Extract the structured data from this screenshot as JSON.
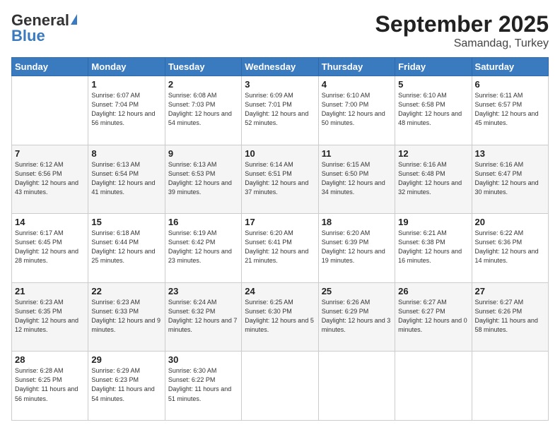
{
  "logo": {
    "general": "General",
    "blue": "Blue"
  },
  "header": {
    "month": "September 2025",
    "location": "Samandag, Turkey"
  },
  "weekdays": [
    "Sunday",
    "Monday",
    "Tuesday",
    "Wednesday",
    "Thursday",
    "Friday",
    "Saturday"
  ],
  "weeks": [
    [
      {
        "day": "",
        "sunrise": "",
        "sunset": "",
        "daylight": ""
      },
      {
        "day": "1",
        "sunrise": "Sunrise: 6:07 AM",
        "sunset": "Sunset: 7:04 PM",
        "daylight": "Daylight: 12 hours and 56 minutes."
      },
      {
        "day": "2",
        "sunrise": "Sunrise: 6:08 AM",
        "sunset": "Sunset: 7:03 PM",
        "daylight": "Daylight: 12 hours and 54 minutes."
      },
      {
        "day": "3",
        "sunrise": "Sunrise: 6:09 AM",
        "sunset": "Sunset: 7:01 PM",
        "daylight": "Daylight: 12 hours and 52 minutes."
      },
      {
        "day": "4",
        "sunrise": "Sunrise: 6:10 AM",
        "sunset": "Sunset: 7:00 PM",
        "daylight": "Daylight: 12 hours and 50 minutes."
      },
      {
        "day": "5",
        "sunrise": "Sunrise: 6:10 AM",
        "sunset": "Sunset: 6:58 PM",
        "daylight": "Daylight: 12 hours and 48 minutes."
      },
      {
        "day": "6",
        "sunrise": "Sunrise: 6:11 AM",
        "sunset": "Sunset: 6:57 PM",
        "daylight": "Daylight: 12 hours and 45 minutes."
      }
    ],
    [
      {
        "day": "7",
        "sunrise": "Sunrise: 6:12 AM",
        "sunset": "Sunset: 6:56 PM",
        "daylight": "Daylight: 12 hours and 43 minutes."
      },
      {
        "day": "8",
        "sunrise": "Sunrise: 6:13 AM",
        "sunset": "Sunset: 6:54 PM",
        "daylight": "Daylight: 12 hours and 41 minutes."
      },
      {
        "day": "9",
        "sunrise": "Sunrise: 6:13 AM",
        "sunset": "Sunset: 6:53 PM",
        "daylight": "Daylight: 12 hours and 39 minutes."
      },
      {
        "day": "10",
        "sunrise": "Sunrise: 6:14 AM",
        "sunset": "Sunset: 6:51 PM",
        "daylight": "Daylight: 12 hours and 37 minutes."
      },
      {
        "day": "11",
        "sunrise": "Sunrise: 6:15 AM",
        "sunset": "Sunset: 6:50 PM",
        "daylight": "Daylight: 12 hours and 34 minutes."
      },
      {
        "day": "12",
        "sunrise": "Sunrise: 6:16 AM",
        "sunset": "Sunset: 6:48 PM",
        "daylight": "Daylight: 12 hours and 32 minutes."
      },
      {
        "day": "13",
        "sunrise": "Sunrise: 6:16 AM",
        "sunset": "Sunset: 6:47 PM",
        "daylight": "Daylight: 12 hours and 30 minutes."
      }
    ],
    [
      {
        "day": "14",
        "sunrise": "Sunrise: 6:17 AM",
        "sunset": "Sunset: 6:45 PM",
        "daylight": "Daylight: 12 hours and 28 minutes."
      },
      {
        "day": "15",
        "sunrise": "Sunrise: 6:18 AM",
        "sunset": "Sunset: 6:44 PM",
        "daylight": "Daylight: 12 hours and 25 minutes."
      },
      {
        "day": "16",
        "sunrise": "Sunrise: 6:19 AM",
        "sunset": "Sunset: 6:42 PM",
        "daylight": "Daylight: 12 hours and 23 minutes."
      },
      {
        "day": "17",
        "sunrise": "Sunrise: 6:20 AM",
        "sunset": "Sunset: 6:41 PM",
        "daylight": "Daylight: 12 hours and 21 minutes."
      },
      {
        "day": "18",
        "sunrise": "Sunrise: 6:20 AM",
        "sunset": "Sunset: 6:39 PM",
        "daylight": "Daylight: 12 hours and 19 minutes."
      },
      {
        "day": "19",
        "sunrise": "Sunrise: 6:21 AM",
        "sunset": "Sunset: 6:38 PM",
        "daylight": "Daylight: 12 hours and 16 minutes."
      },
      {
        "day": "20",
        "sunrise": "Sunrise: 6:22 AM",
        "sunset": "Sunset: 6:36 PM",
        "daylight": "Daylight: 12 hours and 14 minutes."
      }
    ],
    [
      {
        "day": "21",
        "sunrise": "Sunrise: 6:23 AM",
        "sunset": "Sunset: 6:35 PM",
        "daylight": "Daylight: 12 hours and 12 minutes."
      },
      {
        "day": "22",
        "sunrise": "Sunrise: 6:23 AM",
        "sunset": "Sunset: 6:33 PM",
        "daylight": "Daylight: 12 hours and 9 minutes."
      },
      {
        "day": "23",
        "sunrise": "Sunrise: 6:24 AM",
        "sunset": "Sunset: 6:32 PM",
        "daylight": "Daylight: 12 hours and 7 minutes."
      },
      {
        "day": "24",
        "sunrise": "Sunrise: 6:25 AM",
        "sunset": "Sunset: 6:30 PM",
        "daylight": "Daylight: 12 hours and 5 minutes."
      },
      {
        "day": "25",
        "sunrise": "Sunrise: 6:26 AM",
        "sunset": "Sunset: 6:29 PM",
        "daylight": "Daylight: 12 hours and 3 minutes."
      },
      {
        "day": "26",
        "sunrise": "Sunrise: 6:27 AM",
        "sunset": "Sunset: 6:27 PM",
        "daylight": "Daylight: 12 hours and 0 minutes."
      },
      {
        "day": "27",
        "sunrise": "Sunrise: 6:27 AM",
        "sunset": "Sunset: 6:26 PM",
        "daylight": "Daylight: 11 hours and 58 minutes."
      }
    ],
    [
      {
        "day": "28",
        "sunrise": "Sunrise: 6:28 AM",
        "sunset": "Sunset: 6:25 PM",
        "daylight": "Daylight: 11 hours and 56 minutes."
      },
      {
        "day": "29",
        "sunrise": "Sunrise: 6:29 AM",
        "sunset": "Sunset: 6:23 PM",
        "daylight": "Daylight: 11 hours and 54 minutes."
      },
      {
        "day": "30",
        "sunrise": "Sunrise: 6:30 AM",
        "sunset": "Sunset: 6:22 PM",
        "daylight": "Daylight: 11 hours and 51 minutes."
      },
      {
        "day": "",
        "sunrise": "",
        "sunset": "",
        "daylight": ""
      },
      {
        "day": "",
        "sunrise": "",
        "sunset": "",
        "daylight": ""
      },
      {
        "day": "",
        "sunrise": "",
        "sunset": "",
        "daylight": ""
      },
      {
        "day": "",
        "sunrise": "",
        "sunset": "",
        "daylight": ""
      }
    ]
  ]
}
